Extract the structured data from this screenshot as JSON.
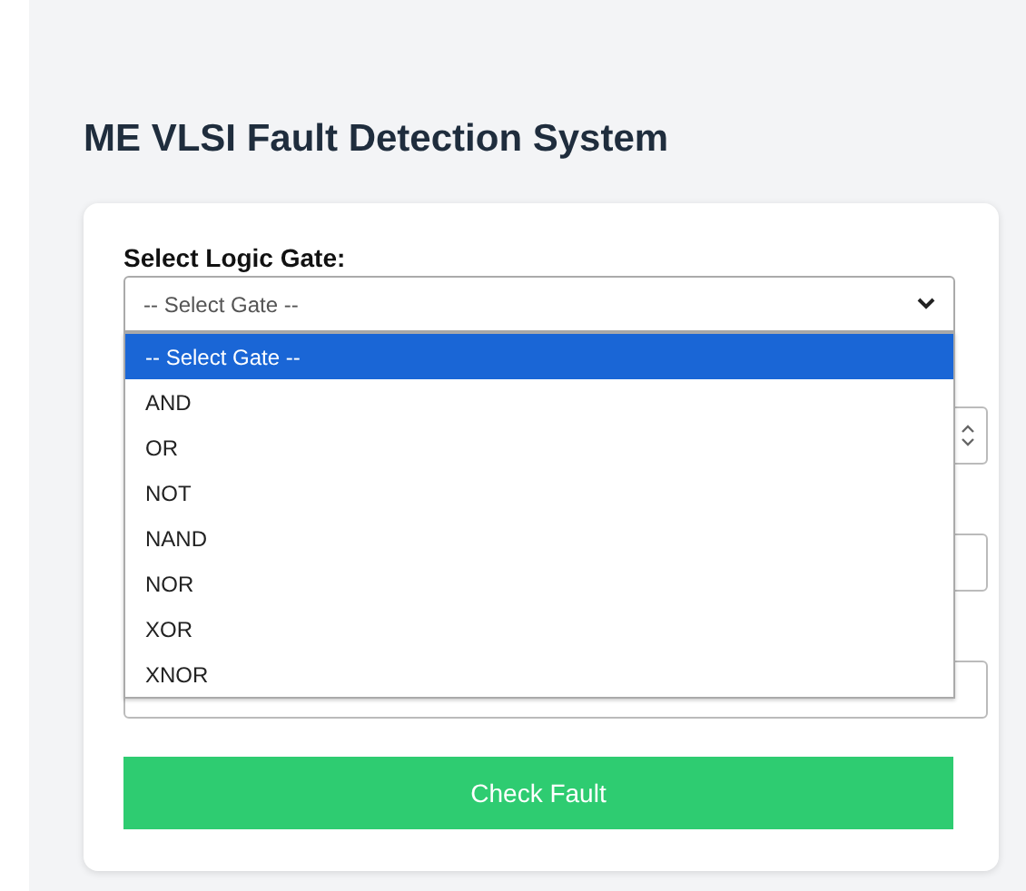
{
  "title": "ME VLSI Fault Detection System",
  "form": {
    "gate_label": "Select Logic Gate:",
    "gate_select": {
      "value": "-- Select Gate --",
      "expanded": true,
      "options": [
        {
          "label": "-- Select Gate --",
          "selected": true
        },
        {
          "label": "AND",
          "selected": false
        },
        {
          "label": "OR",
          "selected": false
        },
        {
          "label": "NOT",
          "selected": false
        },
        {
          "label": "NAND",
          "selected": false
        },
        {
          "label": "NOR",
          "selected": false
        },
        {
          "label": "XOR",
          "selected": false
        },
        {
          "label": "XNOR",
          "selected": false
        }
      ]
    },
    "fields": [
      {
        "kind": "number"
      },
      {
        "kind": "text"
      },
      {
        "kind": "text"
      }
    ],
    "submit": "Check Fault"
  }
}
